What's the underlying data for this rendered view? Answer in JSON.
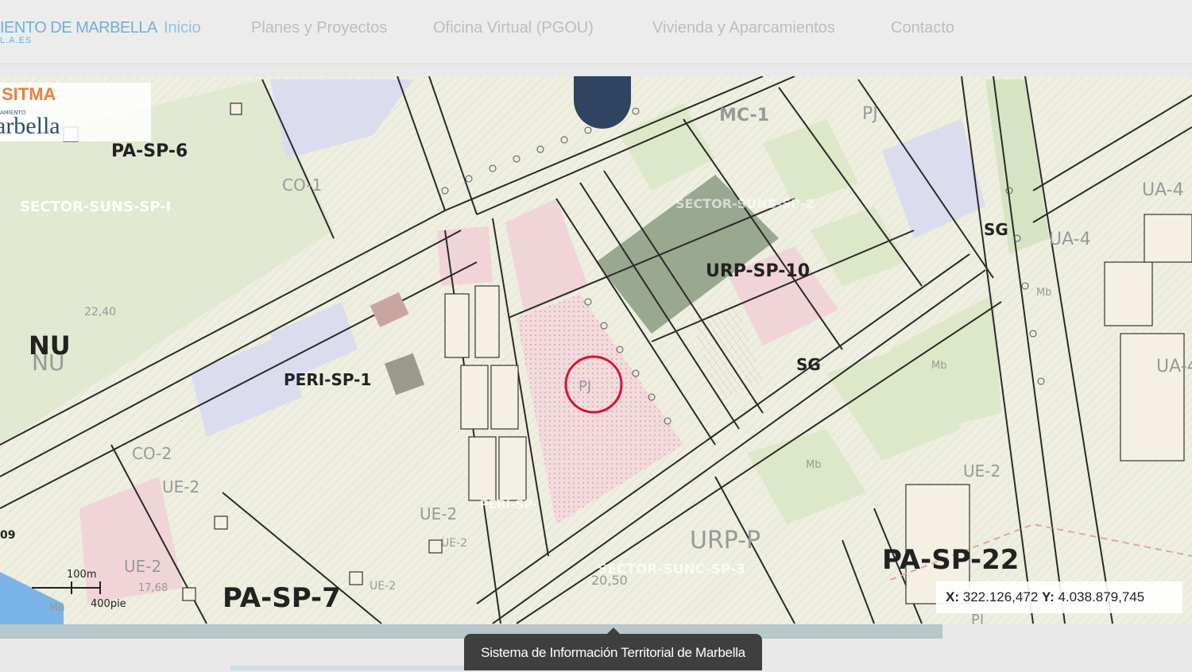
{
  "header": {
    "brand_line1": "IENTO DE MARBELLA",
    "brand_line2": "L.A.ES",
    "nav": [
      {
        "label": "Inicio",
        "active": true
      },
      {
        "label": "Planes y Proyectos",
        "active": false
      },
      {
        "label": "Oficina Virtual (PGOU)",
        "active": false
      },
      {
        "label": "Vivienda y Aparcamientos",
        "active": false
      },
      {
        "label": "Contacto",
        "active": false
      }
    ]
  },
  "logo": {
    "sitma": "SITMA",
    "ayuntamiento": "AMIENTO",
    "marbella": "arbella"
  },
  "map": {
    "labels": {
      "pa_sp_6": "PA-SP-6",
      "sector_suns_sp_i": "SECTOR-SUNS-SP-I",
      "nu": "NU",
      "nu2": "NU",
      "co1": "CO-1",
      "mc1": "MC-1",
      "pj_top": "PJ",
      "urp_sp_10": "URP-SP-10",
      "sector_sp_2": "SECTOR-SUNS-SP-2",
      "sg1": "SG",
      "sg2": "SG",
      "ua4a": "UA-4",
      "ua4b": "UA-4",
      "ua4c": "UA-4",
      "peri_sp_1": "PERI-SP-1",
      "pj_center": "PJ",
      "mb1": "Mb",
      "mb2": "Mb",
      "mb3": "Mb",
      "co2": "CO-2",
      "ue2a": "UE-2",
      "ue2b": "UE-2",
      "ue2c": "UE-2",
      "ue2d": "UE-2",
      "ue2e": "UE-2",
      "ue2f": "UE-2",
      "pa_sp_7": "PA-SP-7",
      "urp_p": "URP-P",
      "sector_sunc_sp3": "SECTOR-SUNC-SP-3",
      "pa_sp_22": "PA-SP-22",
      "num_2240": "22,40",
      "num_2050": "20,50",
      "num_1768": "17,68",
      "num_09": "09",
      "peri_sp": "PERI-SP-",
      "sector_sunc": "SECTOR-SUNC",
      "pj_bottom": "PJ",
      "mb_bottom": "Mb"
    },
    "scale_m": "100m",
    "scale_ft": "400pie"
  },
  "coords": {
    "x_label": "X:",
    "x_value": "322.126,472",
    "y_label": "Y:",
    "y_value": "4.038.879,745"
  },
  "tooltip": "Sistema de Información Territorial de Marbella"
}
